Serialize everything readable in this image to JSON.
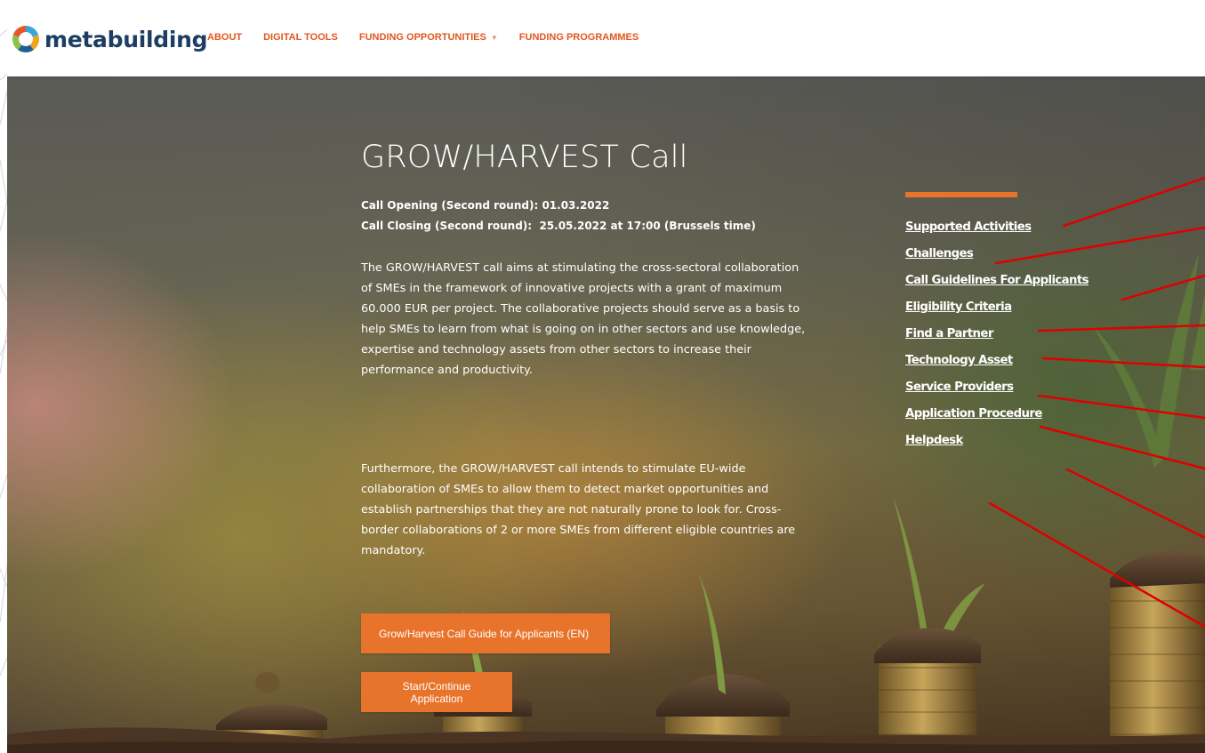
{
  "logo": {
    "text": "metabuilding"
  },
  "nav": {
    "about": "ABOUT",
    "digital_tools": "DIGITAL TOOLS",
    "funding_opportunities": "FUNDING OPPORTUNITIES",
    "funding_programmes": "FUNDING PROGRAMMES"
  },
  "hero": {
    "title": "GROW/HARVEST Call",
    "opening": "Call Opening (Second round): 01.03.2022",
    "closing": "Call Closing (Second round):  25.05.2022 at 17:00 (Brussels time)",
    "paragraph1": "The GROW/HARVEST call aims at stimulating the cross-sectoral collaboration of SMEs in the framework of innovative projects with a grant of maximum 60.000 EUR per project. The collaborative projects should serve as a basis to help SMEs to learn from what is going on in other sectors and use knowledge, expertise and technology assets from other sectors to increase their performance and productivity.",
    "paragraph2": "Furthermore, the GROW/HARVEST call intends to stimulate EU-wide collaboration of SMEs to allow them to detect market opportunities and establish partnerships that they are not naturally prone to look for. Cross-border collaborations of 2 or more SMEs from different eligible countries are mandatory.",
    "guide_button": "Grow/Harvest Call Guide for Applicants (EN)",
    "start_button": "Start/Continue Application"
  },
  "sidebar": {
    "links": [
      {
        "label": "Supported Activities"
      },
      {
        "label": "Challenges"
      },
      {
        "label": "Call Guidelines For Applicants"
      },
      {
        "label": "Eligibility Criteria"
      },
      {
        "label": "Find a Partner"
      },
      {
        "label": "Technology Asset"
      },
      {
        "label": "Service Providers"
      },
      {
        "label": "Application Procedure"
      },
      {
        "label": "Helpdesk"
      }
    ]
  },
  "colors": {
    "accent": "#e8742c",
    "nav_text": "#e2561e",
    "logo_text": "#1d3e62",
    "annotation_lines": "#e00000"
  },
  "icons": {
    "logo": "metabuilding-ring-logo-icon",
    "dropdown": "chevron-down-icon"
  }
}
